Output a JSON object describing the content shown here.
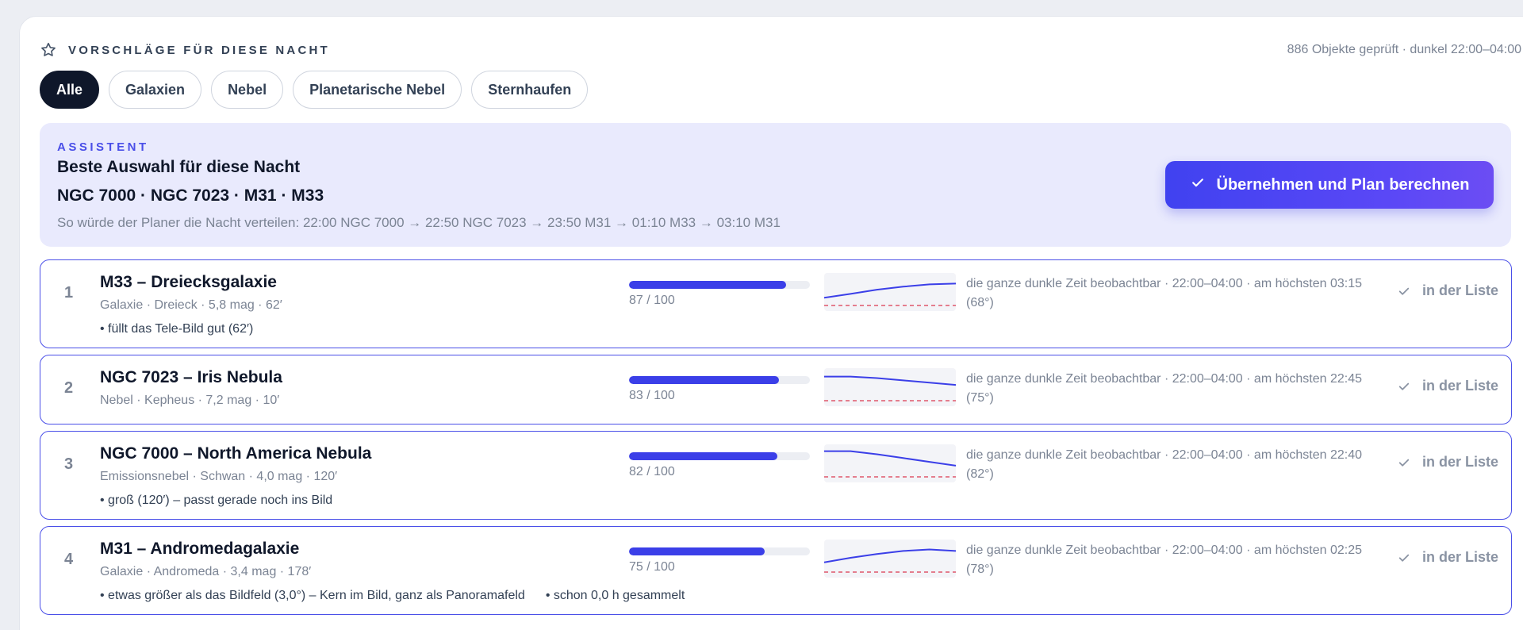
{
  "header": {
    "title": "VORSCHLÄGE FÜR DIESE NACHT",
    "meta": "886 Objekte geprüft · dunkel 22:00–04:00"
  },
  "filters": [
    {
      "label": "Alle",
      "active": true
    },
    {
      "label": "Galaxien",
      "active": false
    },
    {
      "label": "Nebel",
      "active": false
    },
    {
      "label": "Planetarische Nebel",
      "active": false
    },
    {
      "label": "Sternhaufen",
      "active": false
    }
  ],
  "assistant": {
    "label": "ASSISTENT",
    "title": "Beste Auswahl für diese Nacht",
    "picks": "NGC 7000 · NGC 7023 · M31 · M33",
    "plan": "So würde der Planer die Nacht verteilen: 22:00 NGC 7000 → 22:50 NGC 7023 → 23:50 M31 → 01:10 M33 → 03:10 M31",
    "button_label": "Übernehmen und Plan berechnen"
  },
  "accent_color": "#4a4fe8",
  "objects": [
    {
      "rank": "1",
      "name": "M33 – Dreiecksgalaxie",
      "meta": "Galaxie · Dreieck · 5,8 mag · 62′",
      "notes": [
        "• füllt das Tele-Bild gut (62′)"
      ],
      "score": 87,
      "score_text": "87 / 100",
      "visibility": "die ganze dunkle Zeit beobachtbar · 22:00–04:00 · am höchsten 03:15 (68°)",
      "status": "in der Liste",
      "altitude_curve": [
        0.35,
        0.45,
        0.56,
        0.64,
        0.7,
        0.72
      ]
    },
    {
      "rank": "2",
      "name": "NGC 7023 – Iris Nebula",
      "meta": "Nebel · Kepheus · 7,2 mag · 10′",
      "notes": [],
      "score": 83,
      "score_text": "83 / 100",
      "visibility": "die ganze dunkle Zeit beobachtbar · 22:00–04:00 · am höchsten 22:45 (75°)",
      "status": "in der Liste",
      "altitude_curve": [
        0.78,
        0.78,
        0.74,
        0.68,
        0.62,
        0.56
      ]
    },
    {
      "rank": "3",
      "name": "NGC 7000 – North America Nebula",
      "meta": "Emissionsnebel · Schwan · 4,0 mag · 120′",
      "notes": [
        "• groß (120′) – passt gerade noch ins Bild"
      ],
      "score": 82,
      "score_text": "82 / 100",
      "visibility": "die ganze dunkle Zeit beobachtbar · 22:00–04:00 · am höchsten 22:40 (82°)",
      "status": "in der Liste",
      "altitude_curve": [
        0.82,
        0.82,
        0.74,
        0.64,
        0.54,
        0.44
      ]
    },
    {
      "rank": "4",
      "name": "M31 – Andromedagalaxie",
      "meta": "Galaxie · Andromeda · 3,4 mag · 178′",
      "notes": [
        "• etwas größer als das Bildfeld (3,0°) – Kern im Bild, ganz als Panoramafeld",
        "• schon 0,0 h gesammelt"
      ],
      "score": 75,
      "score_text": "75 / 100",
      "visibility": "die ganze dunkle Zeit beobachtbar · 22:00–04:00 · am höchsten 02:25 (78°)",
      "status": "in der Liste",
      "altitude_curve": [
        0.4,
        0.52,
        0.62,
        0.7,
        0.74,
        0.7
      ]
    }
  ]
}
